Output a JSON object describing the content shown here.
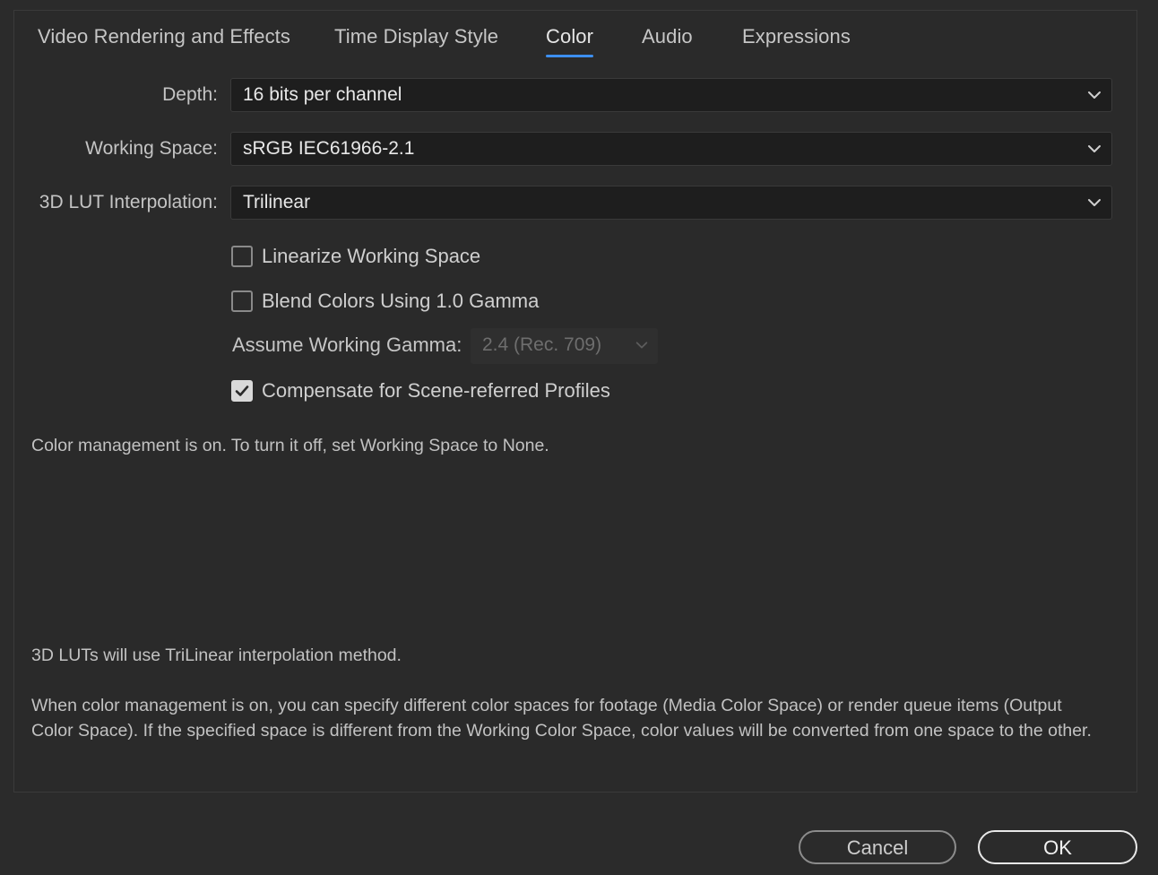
{
  "tabs": [
    {
      "label": "Video Rendering and Effects",
      "active": false
    },
    {
      "label": "Time Display Style",
      "active": false
    },
    {
      "label": "Color",
      "active": true
    },
    {
      "label": "Audio",
      "active": false
    },
    {
      "label": "Expressions",
      "active": false
    }
  ],
  "fields": {
    "depth": {
      "label": "Depth:",
      "value": "16 bits per channel"
    },
    "working_space": {
      "label": "Working Space:",
      "value": "sRGB IEC61966-2.1"
    },
    "lut_interpolation": {
      "label": "3D LUT Interpolation:",
      "value": "Trilinear"
    }
  },
  "checkboxes": {
    "linearize": {
      "label": "Linearize Working Space",
      "checked": false
    },
    "blend": {
      "label": "Blend Colors Using 1.0 Gamma",
      "checked": false
    },
    "compensate": {
      "label": "Compensate for Scene-referred Profiles",
      "checked": true
    }
  },
  "gamma": {
    "label": "Assume Working Gamma:",
    "value": "2.4 (Rec. 709)",
    "disabled": true
  },
  "info": {
    "color_management": "Color management is on. To turn it off, set Working Space to None.",
    "lut_note": "3D LUTs will use TriLinear interpolation method.",
    "explanation": "When color management is on, you can specify different color spaces for footage (Media Color Space) or render queue items (Output Color Space). If the specified space is different from the Working Color Space, color values will be converted from one space to the other."
  },
  "buttons": {
    "cancel": "Cancel",
    "ok": "OK"
  },
  "colors": {
    "accent": "#3d8ff0",
    "background": "#2b2b2b",
    "field": "#1e1e1e"
  },
  "icons": {
    "dropdown": "chevron-down-icon",
    "check": "checkmark-icon"
  }
}
